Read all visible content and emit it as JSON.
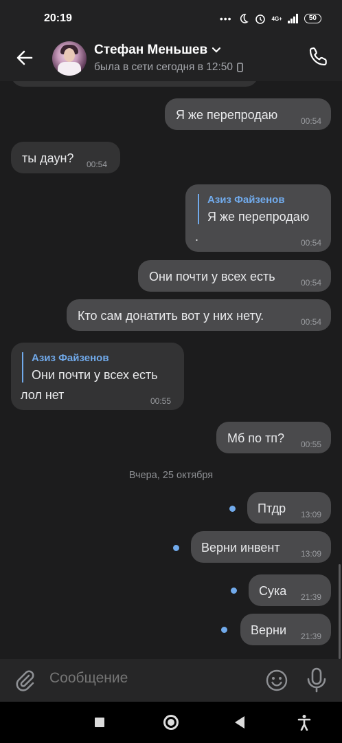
{
  "status_bar": {
    "time": "20:19",
    "signal_text": "4G+",
    "battery": "50"
  },
  "header": {
    "name": "Стефан Меньшев",
    "last_seen": "была в сети сегодня в 12:50"
  },
  "messages": [
    {
      "dir": "out",
      "text": "Я же перепродаю",
      "time": "00:54"
    },
    {
      "dir": "in",
      "text": "ты даун?",
      "time": "00:54"
    },
    {
      "dir": "out",
      "reply_to": {
        "name": "Азиз Файзенов",
        "text": "Я же перепродаю"
      },
      "text": ".",
      "time": "00:54"
    },
    {
      "dir": "out",
      "text": "Они почти у всех есть",
      "time": "00:54"
    },
    {
      "dir": "out",
      "text": "Кто сам донатить вот у них нету.",
      "time": "00:54"
    },
    {
      "dir": "in",
      "reply_to": {
        "name": "Азиз Файзенов",
        "text": "Они почти у всех есть"
      },
      "text": "лол нет",
      "time": "00:55"
    },
    {
      "dir": "out",
      "text": "Мб по тп?",
      "time": "00:55"
    },
    {
      "dir": "out",
      "text": "Птдр",
      "time": "13:09",
      "unread": true
    },
    {
      "dir": "out",
      "text": "Верни инвент",
      "time": "13:09",
      "unread": true
    },
    {
      "dir": "out",
      "text": "Сука",
      "time": "21:39",
      "unread": true
    },
    {
      "dir": "out",
      "text": "Верни",
      "time": "21:39",
      "unread": true
    }
  ],
  "date_separator": "Вчера, 25 октября",
  "composer": {
    "placeholder": "Сообщение"
  },
  "colors": {
    "background": "#1c1c1d",
    "accent": "#71aaeb",
    "outgoing_bubble": "#4a4a4c",
    "incoming_bubble": "#333334"
  },
  "icons": [
    "back-arrow-icon",
    "chevron-down-icon",
    "phone-icon",
    "attach-icon",
    "emoji-icon",
    "microphone-icon",
    "mobile-device-icon"
  ]
}
